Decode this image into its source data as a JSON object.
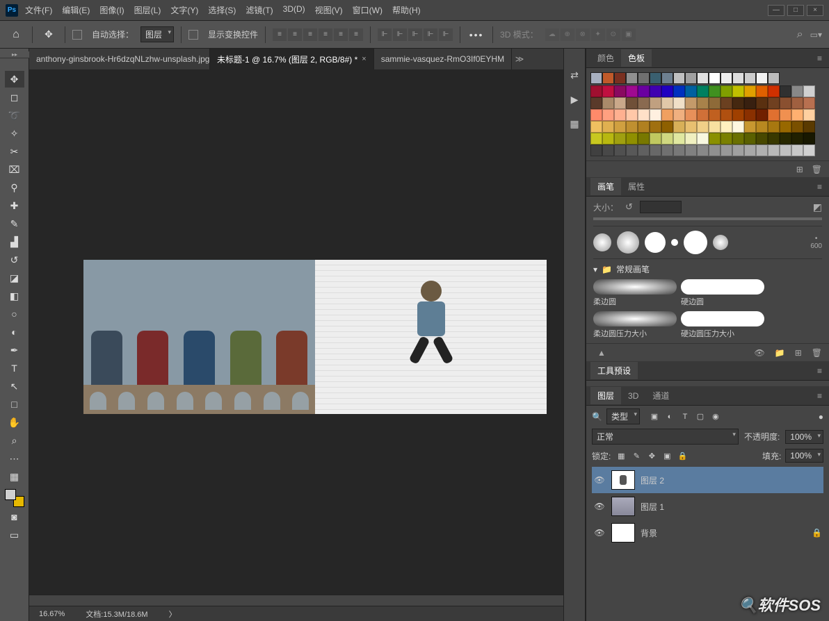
{
  "menu": {
    "items": [
      "文件(F)",
      "编辑(E)",
      "图像(I)",
      "图层(L)",
      "文字(Y)",
      "选择(S)",
      "滤镜(T)",
      "3D(D)",
      "视图(V)",
      "窗口(W)",
      "帮助(H)"
    ]
  },
  "logo": "Ps",
  "winbtns": {
    "min": "—",
    "max": "□",
    "close": "×"
  },
  "optbar": {
    "home": "⌂",
    "move": "✥",
    "auto_select": "自动选择：",
    "layer": "图层",
    "show_transform": "显示变换控件",
    "threed_label": "3D 模式：",
    "search": "⌕",
    "workspace": "▭▾"
  },
  "align_icons": [
    "≡",
    "≡",
    "≡",
    "≡",
    "≡",
    "≡"
  ],
  "dist_icons": [
    "⊩",
    "⊩",
    "⊩",
    "⊩",
    "⊩"
  ],
  "more": "•••",
  "threed_icons": [
    "☁",
    "⊕",
    "⊗",
    "✦",
    "⊙",
    "▣"
  ],
  "tabs": [
    {
      "label": "anthony-ginsbrook-Hr6dzqNLzhw-unsplash.jpg",
      "active": false,
      "close": "×"
    },
    {
      "label": "未标题-1 @ 16.7% (图层 2, RGB/8#) *",
      "active": true,
      "close": "×"
    },
    {
      "label": "sammie-vasquez-RmO3If0EYHM",
      "active": false,
      "close": ""
    }
  ],
  "tab_scroll": "≫",
  "tools": [
    {
      "n": "move",
      "g": "✥",
      "active": true
    },
    {
      "n": "marquee",
      "g": "◻"
    },
    {
      "n": "lasso",
      "g": "➰"
    },
    {
      "n": "quick-select",
      "g": "✧"
    },
    {
      "n": "crop",
      "g": "✂"
    },
    {
      "n": "frame",
      "g": "⌧"
    },
    {
      "n": "eyedropper",
      "g": "⚲"
    },
    {
      "n": "healing",
      "g": "✚"
    },
    {
      "n": "brush",
      "g": "✎"
    },
    {
      "n": "stamp",
      "g": "▟"
    },
    {
      "n": "history-brush",
      "g": "↺"
    },
    {
      "n": "eraser",
      "g": "◪"
    },
    {
      "n": "gradient",
      "g": "◧"
    },
    {
      "n": "blur",
      "g": "○"
    },
    {
      "n": "dodge",
      "g": "◐"
    },
    {
      "n": "pen",
      "g": "✒"
    },
    {
      "n": "type",
      "g": "T"
    },
    {
      "n": "path-select",
      "g": "↖"
    },
    {
      "n": "rectangle",
      "g": "□"
    },
    {
      "n": "hand",
      "g": "✋"
    },
    {
      "n": "zoom",
      "g": "⌕"
    }
  ],
  "tool_extra": {
    "ellipsis": "⋯",
    "edit-toolbar": "▦",
    "swap": "⇄"
  },
  "status": {
    "zoom": "16.67%",
    "doc_label": "文档:",
    "doc": "15.3M/18.6M",
    "more": "〉"
  },
  "dock_icons": [
    "⇄",
    "▶",
    "▦"
  ],
  "color_panel": {
    "tabs": [
      "颜色",
      "色板"
    ]
  },
  "swatch_row": [
    "#a8b0c0",
    "#c05a2a",
    "#7a3020",
    "#909090",
    "#707070",
    "#3a6070",
    "#6e8090",
    "#c0c0c0",
    "#a0a0a0",
    "#e0e0e0",
    "#ffffff",
    "#ededed",
    "#dddddd",
    "#cccccc",
    "#f2f2f2",
    "#bcbcbc"
  ],
  "swatch_rows": [
    [
      "#a01030",
      "#c01040",
      "#8a0a60",
      "#a00a90",
      "#6a00a0",
      "#4000b0",
      "#2000c0",
      "#0030c0",
      "#0060a0",
      "#008060",
      "#409020",
      "#80a000",
      "#c0c000",
      "#e0a000",
      "#e06000",
      "#d03000",
      "#303030",
      "#888888",
      "#d0d0d0"
    ],
    [
      "#5a3a2a",
      "#aa8a6a",
      "#caa88a",
      "#705038",
      "#8a6a50",
      "#c0a080",
      "#e0c8a8",
      "#f0e0c8",
      "#c49a6a",
      "#a8824a",
      "#8e6a38",
      "#6b4020",
      "#452810",
      "#382010",
      "#5a3010",
      "#704020",
      "#8a5030",
      "#a06040",
      "#b87050"
    ],
    [
      "#ff8a6a",
      "#ffa080",
      "#ffb090",
      "#ffc8a8",
      "#ffe0c8",
      "#fff0e0",
      "#f0a060",
      "#f0b080",
      "#e8905a",
      "#d07038",
      "#c06020",
      "#b05010",
      "#a04000",
      "#8a3000",
      "#702000",
      "#e07030",
      "#f09050",
      "#ffb070",
      "#ffd0a0"
    ],
    [
      "#f0c060",
      "#e0b050",
      "#d0a040",
      "#c09030",
      "#b08020",
      "#a07010",
      "#8e6000",
      "#d8b058",
      "#e8c070",
      "#f0d088",
      "#f8e0a0",
      "#fff0c0",
      "#fff8e0",
      "#c89830",
      "#b88820",
      "#a87810",
      "#986800",
      "#7a5000",
      "#5a3a00"
    ],
    [
      "#c8c820",
      "#b8b810",
      "#a0a010",
      "#909000",
      "#787800",
      "#c0c860",
      "#d0d880",
      "#e0e8a0",
      "#f0f0c0",
      "#f8f8e0",
      "#8a9000",
      "#7a8000",
      "#6a7000",
      "#5a6000",
      "#484800",
      "#383800",
      "#282800",
      "#202000",
      "#181800"
    ],
    [
      "#404040",
      "#484848",
      "#505050",
      "#585858",
      "#606060",
      "#686868",
      "#707070",
      "#787878",
      "#808080",
      "#888888",
      "#909090",
      "#989898",
      "#a0a0a0",
      "#a8a8a8",
      "#b0b0b0",
      "#b8b8b8",
      "#c0c0c0",
      "#c8c8c8",
      "#d0d0d0"
    ]
  ],
  "swatch_foot": {
    "new": "⊞",
    "trash": "🗑"
  },
  "brush_panel": {
    "tabs": [
      "画笔",
      "属性"
    ],
    "size_label": "大小：",
    "reset": "↺",
    "toggle": "◩",
    "folder": "常规画笔",
    "max": "600",
    "presets": [
      {
        "label": "柔边圆",
        "hard": false
      },
      {
        "label": "硬边圆",
        "hard": true
      },
      {
        "label": "柔边圆压力大小",
        "hard": false
      },
      {
        "label": "硬边圆压力大小",
        "hard": true
      }
    ],
    "foot_icons": [
      "👁",
      "📁",
      "⊞",
      "🗑"
    ]
  },
  "tool_preset_panel": {
    "tab": "工具预设"
  },
  "layers_panel": {
    "tabs": [
      "图层",
      "3D",
      "通道"
    ],
    "filter_label": "类型",
    "filter_icons": [
      "▣",
      "◐",
      "T",
      "▢",
      "◉"
    ],
    "toggle": "●",
    "blend": "正常",
    "opacity_label": "不透明度:",
    "opacity": "100%",
    "lock_label": "锁定:",
    "lock_icons": [
      "▦",
      "✎",
      "✥",
      "▣",
      "🔒"
    ],
    "fill_label": "填充:",
    "fill": "100%",
    "layers": [
      {
        "name": "图层 2",
        "active": true,
        "thumb": "jumper"
      },
      {
        "name": "图层 1",
        "active": false,
        "thumb": "group"
      },
      {
        "name": "背景",
        "active": false,
        "thumb": "white",
        "locked": true
      }
    ]
  },
  "watermark": "🔍软件SOS"
}
